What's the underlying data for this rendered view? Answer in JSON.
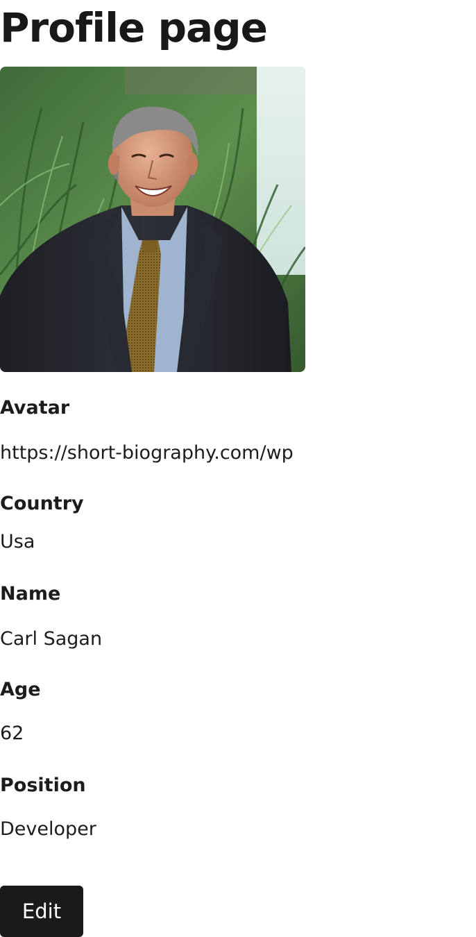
{
  "page": {
    "title": "Profile page"
  },
  "profile": {
    "avatar_alt": "Profile photo of a smiling man in a dark suit and tie",
    "fields": {
      "avatar": {
        "label": "Avatar",
        "value": "https://short-biography.com/wp"
      },
      "country": {
        "label": "Country",
        "value": "Usa"
      },
      "name": {
        "label": "Name",
        "value": "Carl Sagan"
      },
      "age": {
        "label": "Age",
        "value": "62"
      },
      "position": {
        "label": "Position",
        "value": "Developer"
      }
    }
  },
  "actions": {
    "edit_label": "Edit"
  },
  "colors": {
    "text": "#1c1c1e",
    "button_bg": "#1a1a1c",
    "button_text": "#ffffff",
    "background": "#ffffff"
  }
}
